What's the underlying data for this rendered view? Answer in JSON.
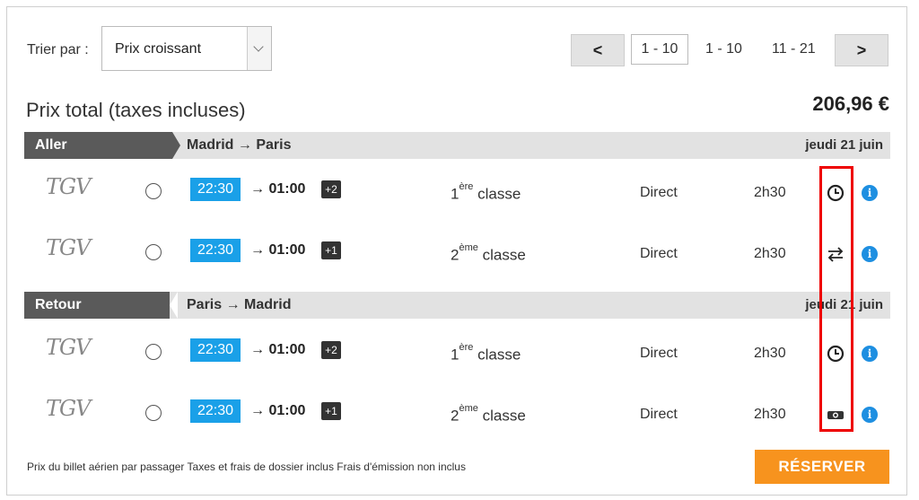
{
  "sort": {
    "label": "Trier par :",
    "selected": "Prix croissant"
  },
  "pagination": {
    "prev": "<",
    "current": "1 - 10",
    "pages": [
      "1 - 10",
      "11 - 21"
    ],
    "next": ">"
  },
  "total": {
    "label": "Prix total (taxes incluses)",
    "price": "206,96 €"
  },
  "aller": {
    "label": "Aller",
    "route": "Madrid  →  Paris",
    "date": "jeudi 21 juin",
    "rows": [
      {
        "brand": "TGV",
        "depart": "22:30",
        "arrival": "→ 01:00",
        "day_offset": "+2",
        "class_num": "1",
        "class_sup": "ère",
        "class_word": "classe",
        "type": "Direct",
        "duration": "2h30",
        "icon": "clock-icon"
      },
      {
        "brand": "TGV",
        "depart": "22:30",
        "arrival": "→ 01:00",
        "day_offset": "+1",
        "class_num": "2",
        "class_sup": "ème",
        "class_word": "classe",
        "type": "Direct",
        "duration": "2h30",
        "icon": "swap-arrows-icon"
      }
    ]
  },
  "retour": {
    "label": "Retour",
    "route": "Paris  →  Madrid",
    "date": "jeudi 21 juin",
    "rows": [
      {
        "brand": "TGV",
        "depart": "22:30",
        "arrival": "→ 01:00",
        "day_offset": "+2",
        "class_num": "1",
        "class_sup": "ère",
        "class_word": "classe",
        "type": "Direct",
        "duration": "2h30",
        "icon": "clock-icon"
      },
      {
        "brand": "TGV",
        "depart": "22:30",
        "arrival": "→ 01:00",
        "day_offset": "+1",
        "class_num": "2",
        "class_sup": "ème",
        "class_word": "classe",
        "type": "Direct",
        "duration": "2h30",
        "icon": "money-icon"
      }
    ]
  },
  "footnote": "Prix du billet aérien par passager Taxes et frais de dossier inclus Frais d'émission non inclus",
  "reserve_label": "RÉSERVER",
  "colors": {
    "accent": "#1aa0e8",
    "reserve": "#f7931e",
    "highlight": "#e00000",
    "bar_dark": "#5a5a5a"
  }
}
